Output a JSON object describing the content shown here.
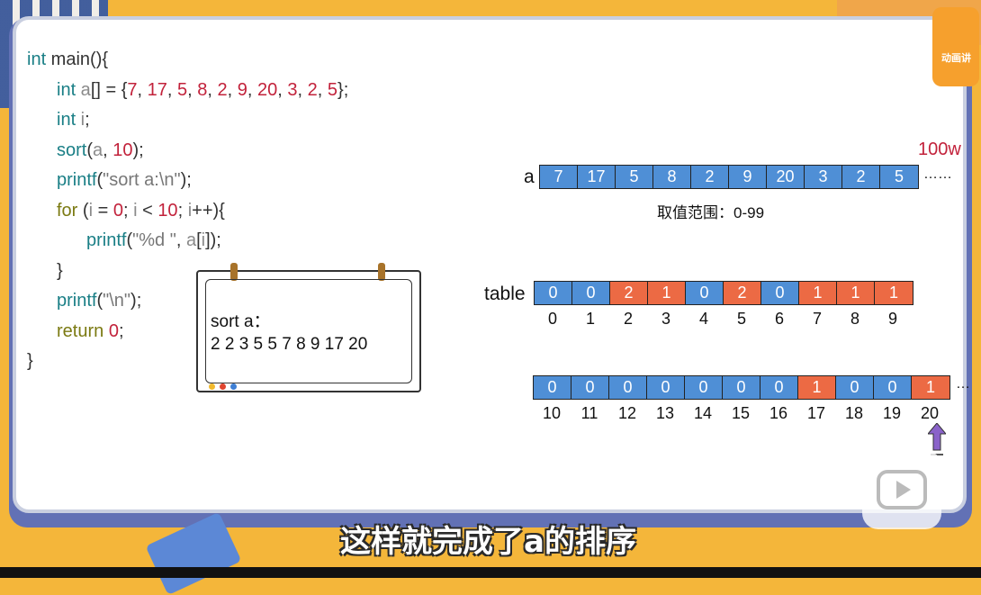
{
  "code_lines": [
    [
      {
        "t": "int",
        "c": "kw"
      },
      {
        "t": " main(){",
        "c": "id"
      }
    ],
    [
      {
        "t": "int",
        "c": "kw"
      },
      {
        "t": " a",
        "c": "var"
      },
      {
        "t": "[] = {",
        "c": "id"
      },
      {
        "t": "7",
        "c": "num"
      },
      {
        "t": ", ",
        "c": "id"
      },
      {
        "t": "17",
        "c": "num"
      },
      {
        "t": ", ",
        "c": "id"
      },
      {
        "t": "5",
        "c": "num"
      },
      {
        "t": ", ",
        "c": "id"
      },
      {
        "t": "8",
        "c": "num"
      },
      {
        "t": ", ",
        "c": "id"
      },
      {
        "t": "2",
        "c": "num"
      },
      {
        "t": ", ",
        "c": "id"
      },
      {
        "t": "9",
        "c": "num"
      },
      {
        "t": ", ",
        "c": "id"
      },
      {
        "t": "20",
        "c": "num"
      },
      {
        "t": ", ",
        "c": "id"
      },
      {
        "t": "3",
        "c": "num"
      },
      {
        "t": ", ",
        "c": "id"
      },
      {
        "t": "2",
        "c": "num"
      },
      {
        "t": ", ",
        "c": "id"
      },
      {
        "t": "5",
        "c": "num"
      },
      {
        "t": "};",
        "c": "id"
      }
    ],
    [
      {
        "t": "int",
        "c": "kw"
      },
      {
        "t": " i",
        "c": "var"
      },
      {
        "t": ";",
        "c": "id"
      }
    ],
    [
      {
        "t": "sort",
        "c": "fn"
      },
      {
        "t": "(",
        "c": "id"
      },
      {
        "t": "a",
        "c": "var"
      },
      {
        "t": ", ",
        "c": "id"
      },
      {
        "t": "10",
        "c": "num"
      },
      {
        "t": ");",
        "c": "id"
      }
    ],
    [
      {
        "t": "printf",
        "c": "fn"
      },
      {
        "t": "(",
        "c": "id"
      },
      {
        "t": "\"sort a:\\n\"",
        "c": "str"
      },
      {
        "t": ");",
        "c": "id"
      }
    ],
    [
      {
        "t": "for",
        "c": "kwol"
      },
      {
        "t": " (",
        "c": "id"
      },
      {
        "t": "i",
        "c": "var"
      },
      {
        "t": " = ",
        "c": "id"
      },
      {
        "t": "0",
        "c": "num"
      },
      {
        "t": "; ",
        "c": "id"
      },
      {
        "t": "i",
        "c": "var"
      },
      {
        "t": " < ",
        "c": "id"
      },
      {
        "t": "10",
        "c": "num"
      },
      {
        "t": "; ",
        "c": "id"
      },
      {
        "t": "i",
        "c": "var"
      },
      {
        "t": "++){",
        "c": "id"
      }
    ],
    [
      {
        "t": "printf",
        "c": "fn"
      },
      {
        "t": "(",
        "c": "id"
      },
      {
        "t": "\"%d \"",
        "c": "str"
      },
      {
        "t": ", ",
        "c": "id"
      },
      {
        "t": "a",
        "c": "var"
      },
      {
        "t": "[",
        "c": "id"
      },
      {
        "t": "i",
        "c": "var"
      },
      {
        "t": "]);",
        "c": "id"
      }
    ],
    [
      {
        "t": "}",
        "c": "id"
      }
    ],
    [
      {
        "t": "printf",
        "c": "fn"
      },
      {
        "t": "(",
        "c": "id"
      },
      {
        "t": "\"\\n\"",
        "c": "str"
      },
      {
        "t": ");",
        "c": "id"
      }
    ],
    [
      {
        "t": "return",
        "c": "ret"
      },
      {
        "t": " ",
        "c": "id"
      },
      {
        "t": "0",
        "c": "num"
      },
      {
        "t": ";",
        "c": "id"
      }
    ],
    [
      {
        "t": "}",
        "c": "id"
      }
    ]
  ],
  "output_board": {
    "line1": "sort a：",
    "line2": "2 2 3 5 5 7 8 9 17 20"
  },
  "array_a": {
    "label": "a",
    "values": [
      "7",
      "17",
      "5",
      "8",
      "2",
      "9",
      "20",
      "3",
      "2",
      "5"
    ],
    "ellipsis": "……",
    "count": "100w",
    "range_note": "取值范围：0-99"
  },
  "table_row1": {
    "label": "table",
    "values": [
      "0",
      "0",
      "2",
      "1",
      "0",
      "2",
      "0",
      "1",
      "1",
      "1"
    ],
    "colors": [
      "blue",
      "blue",
      "orange",
      "orange",
      "blue",
      "orange",
      "blue",
      "orange",
      "orange",
      "orange"
    ],
    "indices": [
      "0",
      "1",
      "2",
      "3",
      "4",
      "5",
      "6",
      "7",
      "8",
      "9"
    ]
  },
  "table_row2": {
    "values": [
      "0",
      "0",
      "0",
      "0",
      "0",
      "0",
      "0",
      "1",
      "0",
      "0",
      "1"
    ],
    "colors": [
      "blue",
      "blue",
      "blue",
      "blue",
      "blue",
      "blue",
      "blue",
      "orange",
      "blue",
      "blue",
      "orange"
    ],
    "indices": [
      "10",
      "11",
      "12",
      "13",
      "14",
      "15",
      "16",
      "17",
      "18",
      "19",
      "20"
    ],
    "ellipsis": "…"
  },
  "subtitle": "这样就完成了a的排序",
  "logo_text": "动画讲",
  "colors": {
    "blue": "#4f8fd6",
    "orange": "#ec6a44",
    "keyword": "#1a7f86",
    "number": "#c2223b"
  }
}
